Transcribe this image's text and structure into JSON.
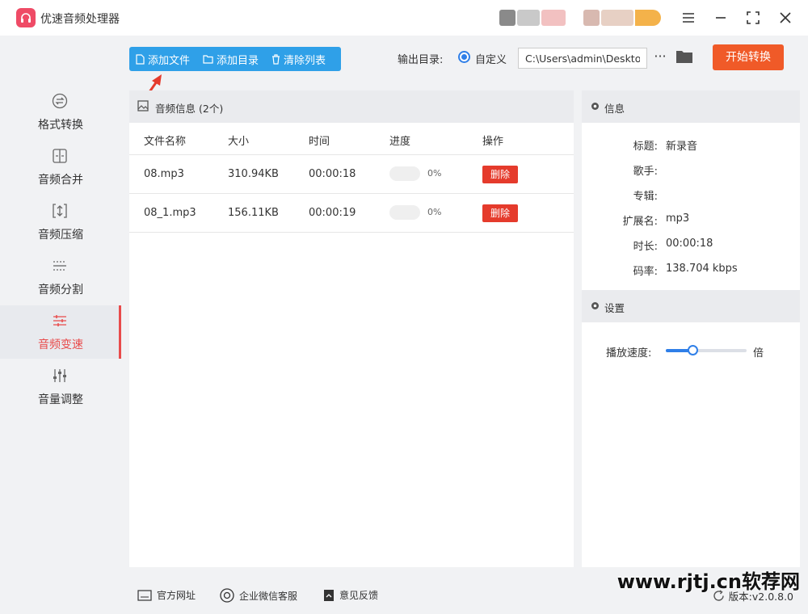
{
  "app": {
    "title": "优速音频处理器"
  },
  "sidebar": {
    "items": [
      {
        "label": "格式转换",
        "icon": "convert-icon"
      },
      {
        "label": "音频合并",
        "icon": "merge-icon"
      },
      {
        "label": "音频压缩",
        "icon": "compress-icon"
      },
      {
        "label": "音频分割",
        "icon": "split-icon"
      },
      {
        "label": "音频变速",
        "icon": "speed-icon",
        "active": true
      },
      {
        "label": "音量调整",
        "icon": "volume-icon"
      }
    ]
  },
  "toolbar": {
    "add_file": "添加文件",
    "add_dir": "添加目录",
    "clear_list": "清除列表",
    "output_label": "输出目录:",
    "custom_label": "自定义",
    "output_path": "C:\\Users\\admin\\Deskto",
    "more": "···",
    "start": "开始转换"
  },
  "file_list": {
    "title": "音频信息",
    "count": "(2个)",
    "columns": [
      "文件名称",
      "大小",
      "时间",
      "进度",
      "操作"
    ],
    "rows": [
      {
        "name": "08.mp3",
        "size": "310.94KB",
        "time": "00:00:18",
        "progress": "0%",
        "action": "删除"
      },
      {
        "name": "08_1.mp3",
        "size": "156.11KB",
        "time": "00:00:19",
        "progress": "0%",
        "action": "删除"
      }
    ]
  },
  "info": {
    "title": "信息",
    "fields": [
      {
        "key": "标题:",
        "value": "新录音"
      },
      {
        "key": "歌手:",
        "value": ""
      },
      {
        "key": "专辑:",
        "value": ""
      },
      {
        "key": "扩展名:",
        "value": "mp3"
      },
      {
        "key": "时长:",
        "value": "00:00:18"
      },
      {
        "key": "码率:",
        "value": "138.704 kbps"
      }
    ]
  },
  "settings": {
    "title": "设置",
    "speed_label": "播放速度:",
    "speed_unit": "倍",
    "speed_fraction": 0.33
  },
  "footer": {
    "website": "官方网址",
    "wechat": "企业微信客服",
    "feedback": "意见反馈",
    "version": "版本:v2.0.8.0"
  },
  "watermark": "www.rjtj.cn软荐网",
  "colors": {
    "accent": "#e84b4b",
    "primary": "#2fa0e8",
    "start": "#f05a28",
    "delete": "#e53b2c"
  }
}
